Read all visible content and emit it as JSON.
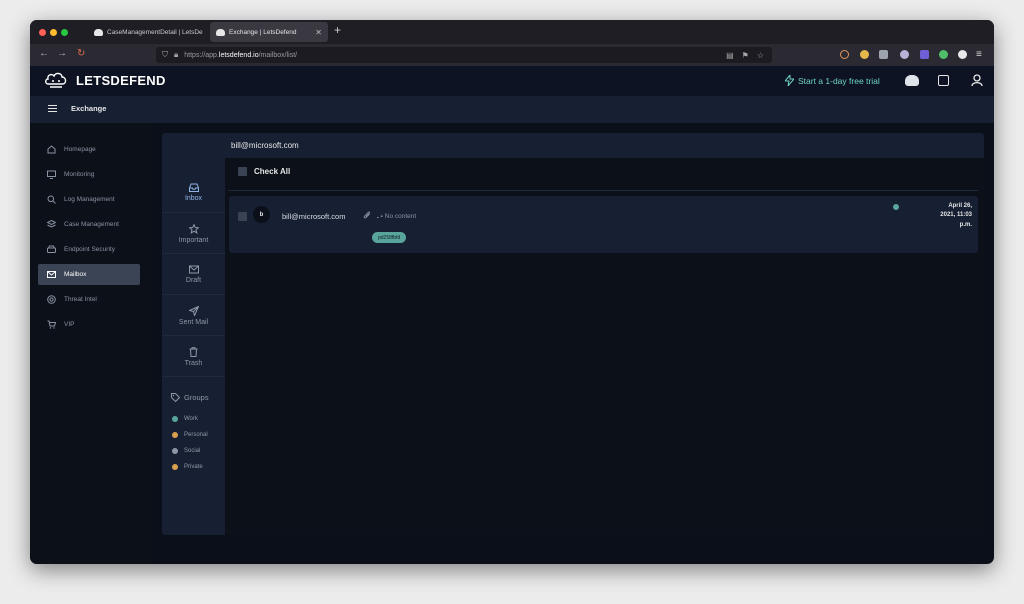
{
  "browser": {
    "tabs": [
      {
        "label": "CaseManagementDetail | LetsDe",
        "active": false
      },
      {
        "label": "Exchange | LetsDefend",
        "active": true
      }
    ],
    "url": {
      "prefix": "https://app.",
      "domain": "letsdefend.io",
      "path": "/mailbox/list/"
    }
  },
  "app": {
    "logo": "LETSDEFEND",
    "trial_label": "Start a 1-day free trial",
    "section_title": "Exchange"
  },
  "sidebar": {
    "items": [
      {
        "label": "Homepage",
        "icon": "home-icon",
        "active": false
      },
      {
        "label": "Monitoring",
        "icon": "monitor-icon",
        "active": false
      },
      {
        "label": "Log Management",
        "icon": "search-icon",
        "active": false
      },
      {
        "label": "Case Management",
        "icon": "layers-icon",
        "active": false
      },
      {
        "label": "Endpoint Security",
        "icon": "hdd-icon",
        "active": false
      },
      {
        "label": "Mailbox",
        "icon": "mail-icon",
        "active": true
      },
      {
        "label": "Threat Intel",
        "icon": "target-icon",
        "active": false
      },
      {
        "label": "VIP",
        "icon": "cart-icon",
        "active": false
      }
    ]
  },
  "mailbox": {
    "nav": [
      {
        "label": "Inbox",
        "icon": "inbox-icon",
        "active": true
      },
      {
        "label": "Important",
        "icon": "star-icon",
        "active": false
      },
      {
        "label": "Draft",
        "icon": "mail-icon",
        "active": false
      },
      {
        "label": "Sent Mail",
        "icon": "send-icon",
        "active": false
      },
      {
        "label": "Trash",
        "icon": "trash-icon",
        "active": false
      }
    ],
    "groups_title": "Groups",
    "groups": [
      {
        "label": "Work",
        "color": "#5aa59b"
      },
      {
        "label": "Personal",
        "color": "#d9a04b"
      },
      {
        "label": "Social",
        "color": "#8e97a6"
      },
      {
        "label": "Private",
        "color": "#d9a04b"
      }
    ],
    "search_value": "bill@microsoft.com",
    "check_all_label": "Check All",
    "emails": [
      {
        "avatar": "b",
        "sender": "bill@microsoft.com",
        "subject_dash": ". -",
        "subject": "No content",
        "tag": "pd258fbfd",
        "date_line1": "April 26,",
        "date_line2": "2021, 11:03",
        "date_line3": "p.m."
      }
    ]
  },
  "colors": {
    "accent": "#6fd3c4",
    "active_item": "#3b4454",
    "tag": "#5aa59b"
  }
}
